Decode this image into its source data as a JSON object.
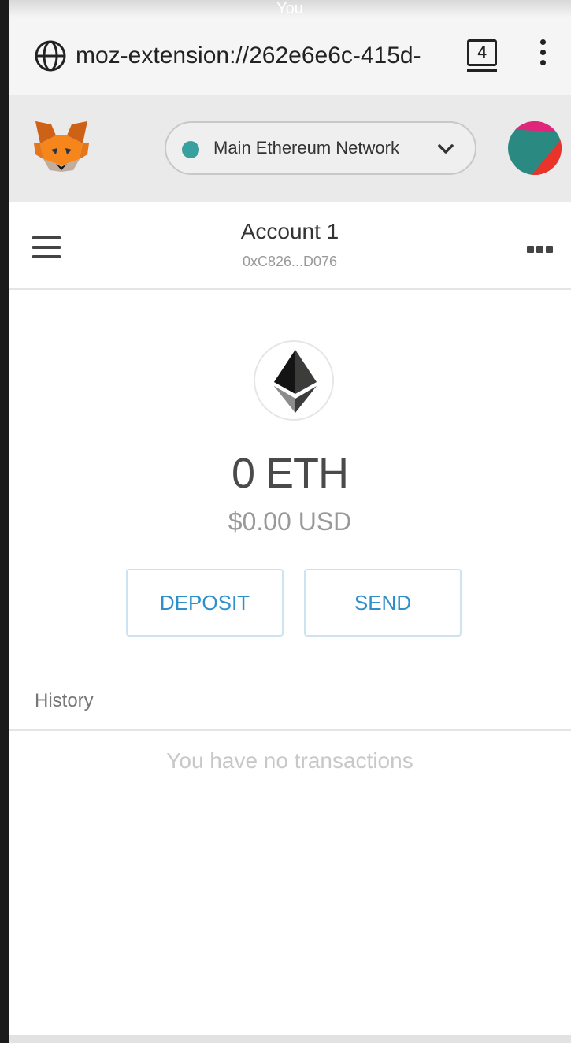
{
  "status_bar": {
    "text": "You"
  },
  "browser": {
    "url": "moz-extension://262e6e6c-415d-",
    "tab_count": "4",
    "icons": {
      "site": "globe-icon",
      "tabs": "tab-count-icon",
      "menu": "kebab-menu-icon"
    }
  },
  "metamask_header": {
    "logo": "metamask-fox-logo",
    "network": {
      "label": "Main Ethereum Network",
      "status_color": "#39a0a0"
    },
    "avatar": "account-identicon"
  },
  "account": {
    "name": "Account 1",
    "address": "0xC826...D076"
  },
  "balance": {
    "token_icon": "ethereum-logo",
    "eth": "0 ETH",
    "usd": "$0.00 USD"
  },
  "actions": {
    "deposit_label": "DEPOSIT",
    "send_label": "SEND"
  },
  "history": {
    "label": "History",
    "empty_message": "You have no transactions"
  },
  "colors": {
    "accent": "#2f8fca",
    "header_bg": "#eaeaea"
  }
}
